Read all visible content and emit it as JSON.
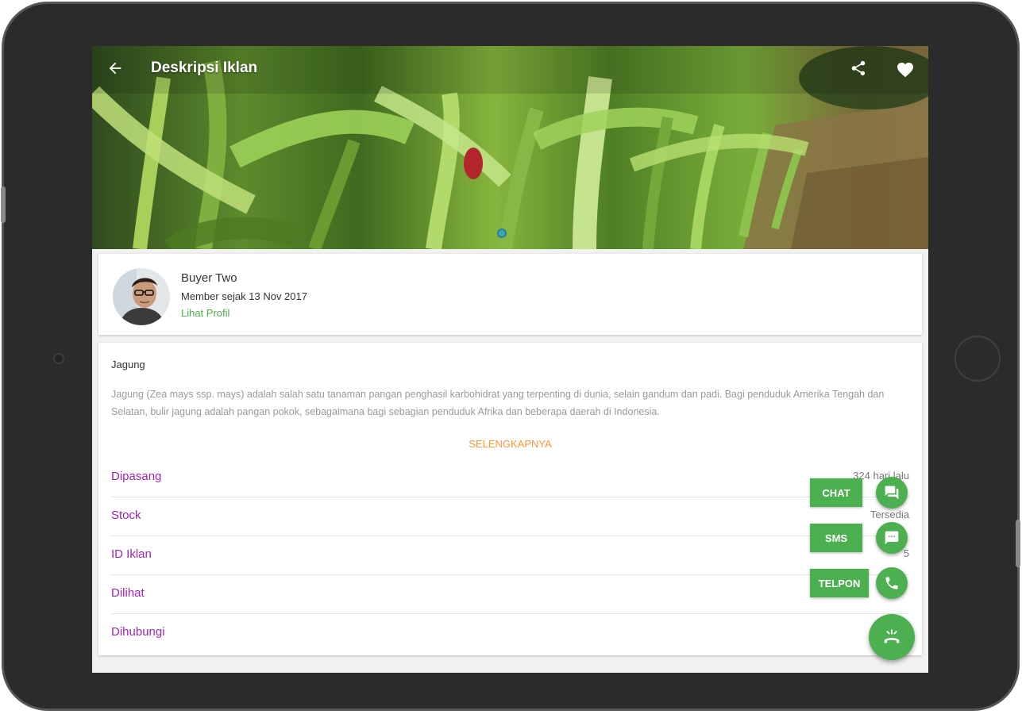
{
  "header": {
    "title": "Deskripsi Iklan",
    "back_icon": "arrow-back-icon",
    "share_icon": "share-icon",
    "favorite_icon": "heart-icon"
  },
  "gallery": {
    "active_index": 1,
    "total": 1
  },
  "seller": {
    "name": "Buyer Two",
    "member_since": "Member sejak 13 Nov 2017",
    "profile_link": "Lihat Profil"
  },
  "listing": {
    "title": "Jagung",
    "description": "Jagung (Zea mays ssp. mays) adalah salah satu tanaman pangan penghasil karbohidrat yang terpenting di dunia, selain gandum dan padi. Bagi penduduk Amerika Tengah dan Selatan, bulir jagung adalah pangan pokok, sebagaimana bagi sebagian penduduk Afrika dan beberapa daerah di Indonesia.",
    "more_label": "SELENGKAPNYA",
    "details": [
      {
        "label": "Dipasang",
        "value": "324 hari lalu"
      },
      {
        "label": "Stock",
        "value": "Tersedia"
      },
      {
        "label": "ID Iklan",
        "value": "5"
      },
      {
        "label": "Dilihat",
        "value": ""
      },
      {
        "label": "Dihubungi",
        "value": ""
      }
    ]
  },
  "contact_actions": {
    "chat_label": "CHAT",
    "sms_label": "SMS",
    "call_label": "TELPON",
    "chat_icon": "chat-icon",
    "sms_icon": "message-icon",
    "call_icon": "phone-icon",
    "main_icon": "phone-hangup-icon"
  },
  "colors": {
    "accent": "#4caf50",
    "detail_label": "#9c27b0",
    "more_link": "#f59a3b",
    "pager_dot": "#3aa6b9"
  }
}
